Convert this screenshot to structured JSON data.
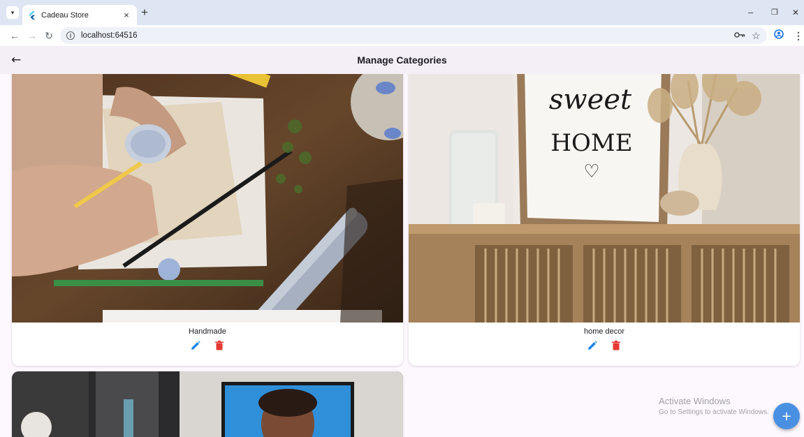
{
  "browser": {
    "tab_title": "Cadeau Store",
    "url": "localhost:64516",
    "tab_close": "×",
    "new_tab": "+",
    "win_min": "–",
    "win_restore": "❐",
    "win_close": "✕"
  },
  "appbar": {
    "title": "Manage Categories",
    "back_icon": "←"
  },
  "categories": [
    {
      "name": "Handmade",
      "image": "handmade-crafts-photo"
    },
    {
      "name": "home decor",
      "image": "sweet-home-decor-photo",
      "image_text": [
        "sweet",
        "HOME",
        "♡"
      ]
    },
    {
      "name": "",
      "image": "person-on-monitor-photo"
    }
  ],
  "fab": {
    "label": "+"
  },
  "watermark": {
    "line1": "Activate Windows",
    "line2": "Go to Settings to activate Windows."
  },
  "colors": {
    "edit": "#1e88e5",
    "delete": "#e53935",
    "fab": "#4a90e2",
    "appbar": "#f4eff7"
  },
  "icons": [
    "back-arrow-icon",
    "edit-pencil-icon",
    "delete-trash-icon",
    "plus-icon",
    "star-icon",
    "key-icon",
    "profile-icon",
    "more-vert-icon"
  ]
}
